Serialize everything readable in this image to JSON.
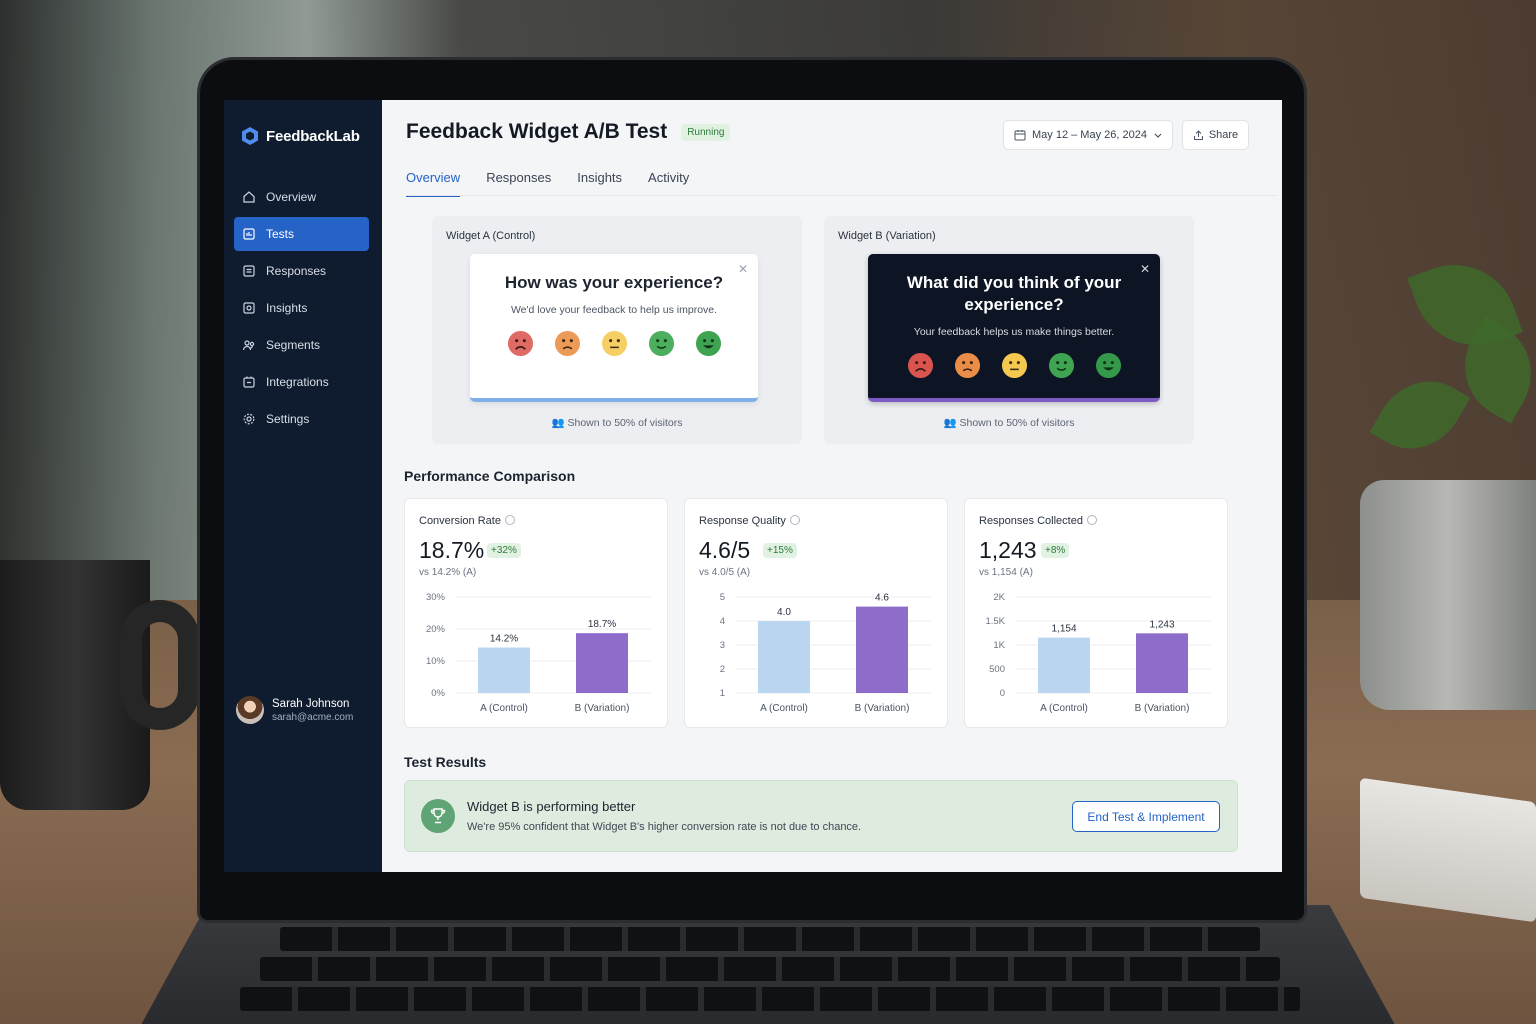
{
  "app": {
    "brand": "FeedbackLab"
  },
  "sidebar": {
    "items": [
      {
        "label": "Overview",
        "icon": "home-icon",
        "active": false
      },
      {
        "label": "Tests",
        "icon": "tests-icon",
        "active": true
      },
      {
        "label": "Responses",
        "icon": "responses-icon",
        "active": false
      },
      {
        "label": "Insights",
        "icon": "insights-icon",
        "active": false
      },
      {
        "label": "Segments",
        "icon": "segments-icon",
        "active": false
      },
      {
        "label": "Integrations",
        "icon": "integrations-icon",
        "active": false
      },
      {
        "label": "Settings",
        "icon": "gear-icon",
        "active": false
      }
    ],
    "user": {
      "name": "Sarah Johnson",
      "email": "sarah@acme.com"
    }
  },
  "header": {
    "title": "Feedback Widget A/B Test",
    "status": "Running",
    "date_range": "May 12 – May 26, 2024",
    "share_label": "Share"
  },
  "tabs": [
    {
      "label": "Overview",
      "active": true
    },
    {
      "label": "Responses",
      "active": false
    },
    {
      "label": "Insights",
      "active": false
    },
    {
      "label": "Activity",
      "active": false
    }
  ],
  "widgets": {
    "a": {
      "label": "Widget A (Control)",
      "question": "How was your experience?",
      "subtitle": "We'd love your feedback to help us improve.",
      "shown": "Shown to 50% of visitors"
    },
    "b": {
      "label": "Widget B (Variation)",
      "question": "What did you think of your experience?",
      "subtitle": "Your feedback helps us make things better.",
      "shown": "Shown to 50% of visitors"
    }
  },
  "sections": {
    "performance": "Performance Comparison",
    "results": "Test Results"
  },
  "metrics": [
    {
      "label": "Conversion Rate",
      "value": "18.7%",
      "delta": "+32%",
      "vs": "vs 14.2% (A)"
    },
    {
      "label": "Response Quality",
      "value": "4.6/5",
      "delta": "+15%",
      "vs": "vs 4.0/5 (A)"
    },
    {
      "label": "Responses Collected",
      "value": "1,243",
      "delta": "+8%",
      "vs": "vs 1,154 (A)"
    }
  ],
  "results": {
    "title": "Widget B is performing better",
    "detail": "We're 95% confident that Widget B's higher conversion rate is not due to chance.",
    "button": "End Test & Implement"
  },
  "colors": {
    "accent": "#2563c7",
    "sidebar": "#0f1b2e",
    "control_bar": "#b9d5ef",
    "variation_bar": "#8e6cc9",
    "success": "#5ea474"
  },
  "chart_data": [
    {
      "type": "bar",
      "title": "Conversion Rate",
      "categories": [
        "A (Control)",
        "B (Variation)"
      ],
      "values": [
        14.2,
        18.7
      ],
      "data_labels": [
        "14.2%",
        "18.7%"
      ],
      "yticks": [
        0,
        10,
        20,
        30
      ],
      "ytick_labels": [
        "0%",
        "10%",
        "20%",
        "30%"
      ],
      "ylim": [
        0,
        30
      ],
      "grid": true
    },
    {
      "type": "bar",
      "title": "Response Quality",
      "categories": [
        "A (Control)",
        "B (Variation)"
      ],
      "values": [
        4.0,
        4.6
      ],
      "data_labels": [
        "4.0",
        "4.6"
      ],
      "yticks": [
        1,
        2,
        3,
        4,
        5
      ],
      "ytick_labels": [
        "1",
        "2",
        "3",
        "4",
        "5"
      ],
      "ylim": [
        1,
        5
      ],
      "grid": true
    },
    {
      "type": "bar",
      "title": "Responses Collected",
      "categories": [
        "A (Control)",
        "B (Variation)"
      ],
      "values": [
        1154,
        1243
      ],
      "data_labels": [
        "1,154",
        "1,243"
      ],
      "yticks": [
        0,
        500,
        1000,
        1500,
        2000
      ],
      "ytick_labels": [
        "0",
        "500",
        "1K",
        "1.5K",
        "2K"
      ],
      "ylim": [
        0,
        2000
      ],
      "grid": true
    }
  ]
}
